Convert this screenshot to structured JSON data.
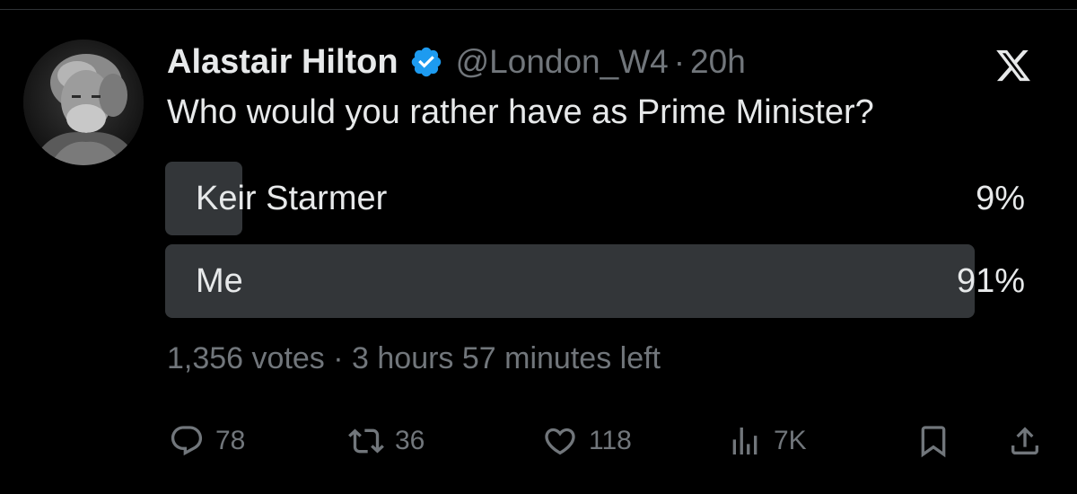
{
  "tweet": {
    "author_name": "Alastair Hilton",
    "handle": "@London_W4",
    "separator": "·",
    "time": "20h",
    "text": "Who would you rather have as Prime Minister?"
  },
  "poll": {
    "options": [
      {
        "label": "Keir Starmer",
        "percent_label": "9%",
        "fraction": 0.09
      },
      {
        "label": "Me",
        "percent_label": "91%",
        "fraction": 0.94
      }
    ],
    "votes": "1,356 votes",
    "separator": "·",
    "time_left": "3 hours 57 minutes left"
  },
  "actions": {
    "reply_count": "78",
    "repost_count": "36",
    "like_count": "118",
    "views_count": "7K"
  },
  "icons": {
    "verified": "verified-badge-icon",
    "x_logo": "x-logo-icon",
    "reply": "reply-icon",
    "repost": "repost-icon",
    "like": "heart-icon",
    "views": "views-icon",
    "bookmark": "bookmark-icon",
    "share": "share-icon"
  },
  "colors": {
    "background": "#000000",
    "text_primary": "#e7e9ea",
    "text_secondary": "#71767b",
    "poll_fill": "#333639",
    "verified": "#1d9bf0"
  }
}
